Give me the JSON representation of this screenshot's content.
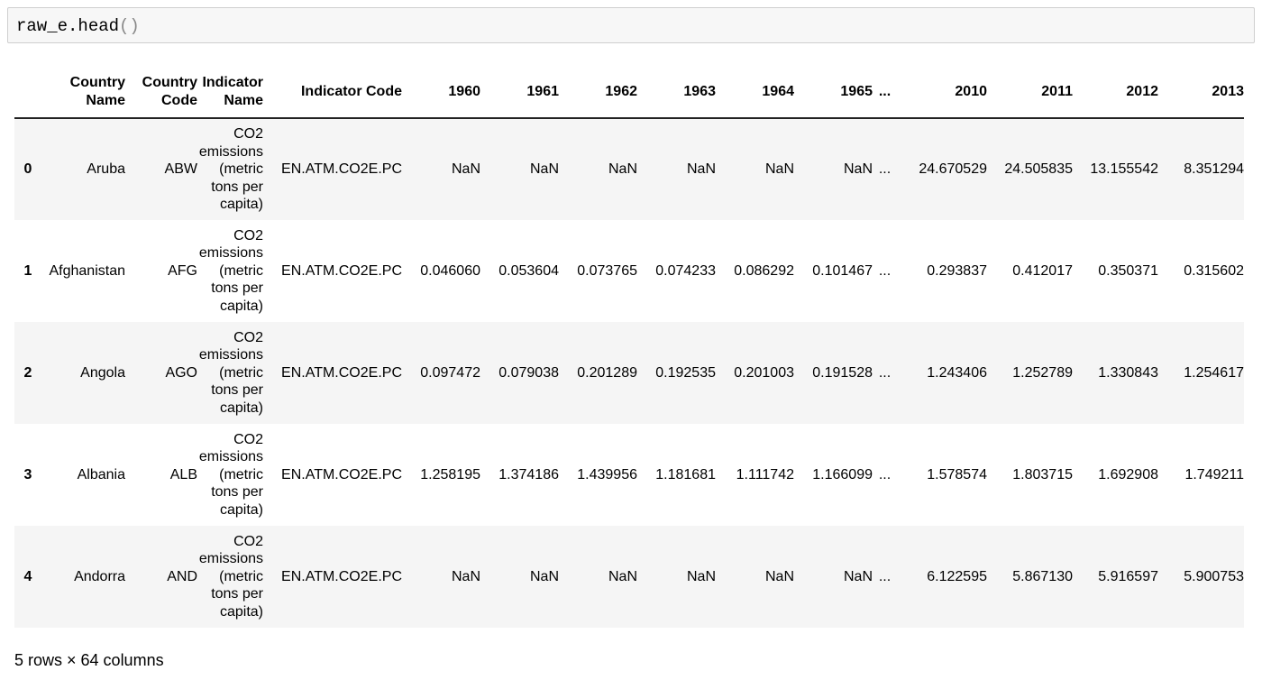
{
  "cell": {
    "code_name": "raw_e.head",
    "code_parens": "()"
  },
  "table": {
    "headers": {
      "index": "",
      "country_name": [
        "Country",
        "Name"
      ],
      "country_code": [
        "Country",
        "Code"
      ],
      "indicator_name": [
        "Indicator",
        "Name"
      ],
      "indicator_code": "Indicator Code",
      "years": [
        "1960",
        "1961",
        "1962",
        "1963",
        "1964",
        "1965",
        "...",
        "2010",
        "2011",
        "2012",
        "2013"
      ]
    },
    "rows": [
      {
        "index": "0",
        "country_name": "Aruba",
        "country_code": "ABW",
        "indicator_name": [
          "CO2",
          "emissions",
          "(metric",
          "tons per",
          "capita)"
        ],
        "indicator_code": "EN.ATM.CO2E.PC",
        "values": [
          "NaN",
          "NaN",
          "NaN",
          "NaN",
          "NaN",
          "NaN",
          "...",
          "24.670529",
          "24.505835",
          "13.155542",
          "8.351294"
        ]
      },
      {
        "index": "1",
        "country_name": "Afghanistan",
        "country_code": "AFG",
        "indicator_name": [
          "CO2",
          "emissions",
          "(metric",
          "tons per",
          "capita)"
        ],
        "indicator_code": "EN.ATM.CO2E.PC",
        "values": [
          "0.046060",
          "0.053604",
          "0.073765",
          "0.074233",
          "0.086292",
          "0.101467",
          "...",
          "0.293837",
          "0.412017",
          "0.350371",
          "0.315602"
        ]
      },
      {
        "index": "2",
        "country_name": "Angola",
        "country_code": "AGO",
        "indicator_name": [
          "CO2",
          "emissions",
          "(metric",
          "tons per",
          "capita)"
        ],
        "indicator_code": "EN.ATM.CO2E.PC",
        "values": [
          "0.097472",
          "0.079038",
          "0.201289",
          "0.192535",
          "0.201003",
          "0.191528",
          "...",
          "1.243406",
          "1.252789",
          "1.330843",
          "1.254617"
        ]
      },
      {
        "index": "3",
        "country_name": "Albania",
        "country_code": "ALB",
        "indicator_name": [
          "CO2",
          "emissions",
          "(metric",
          "tons per",
          "capita)"
        ],
        "indicator_code": "EN.ATM.CO2E.PC",
        "values": [
          "1.258195",
          "1.374186",
          "1.439956",
          "1.181681",
          "1.111742",
          "1.166099",
          "...",
          "1.578574",
          "1.803715",
          "1.692908",
          "1.749211"
        ]
      },
      {
        "index": "4",
        "country_name": "Andorra",
        "country_code": "AND",
        "indicator_name": [
          "CO2",
          "emissions",
          "(metric",
          "tons per",
          "capita)"
        ],
        "indicator_code": "EN.ATM.CO2E.PC",
        "values": [
          "NaN",
          "NaN",
          "NaN",
          "NaN",
          "NaN",
          "NaN",
          "...",
          "6.122595",
          "5.867130",
          "5.916597",
          "5.900753"
        ]
      }
    ]
  },
  "summary": "5 rows × 64 columns",
  "colors": {
    "code_background": "#f7f7f7",
    "code_border": "#cfcfcf",
    "striped_row": "#f5f5f5"
  }
}
